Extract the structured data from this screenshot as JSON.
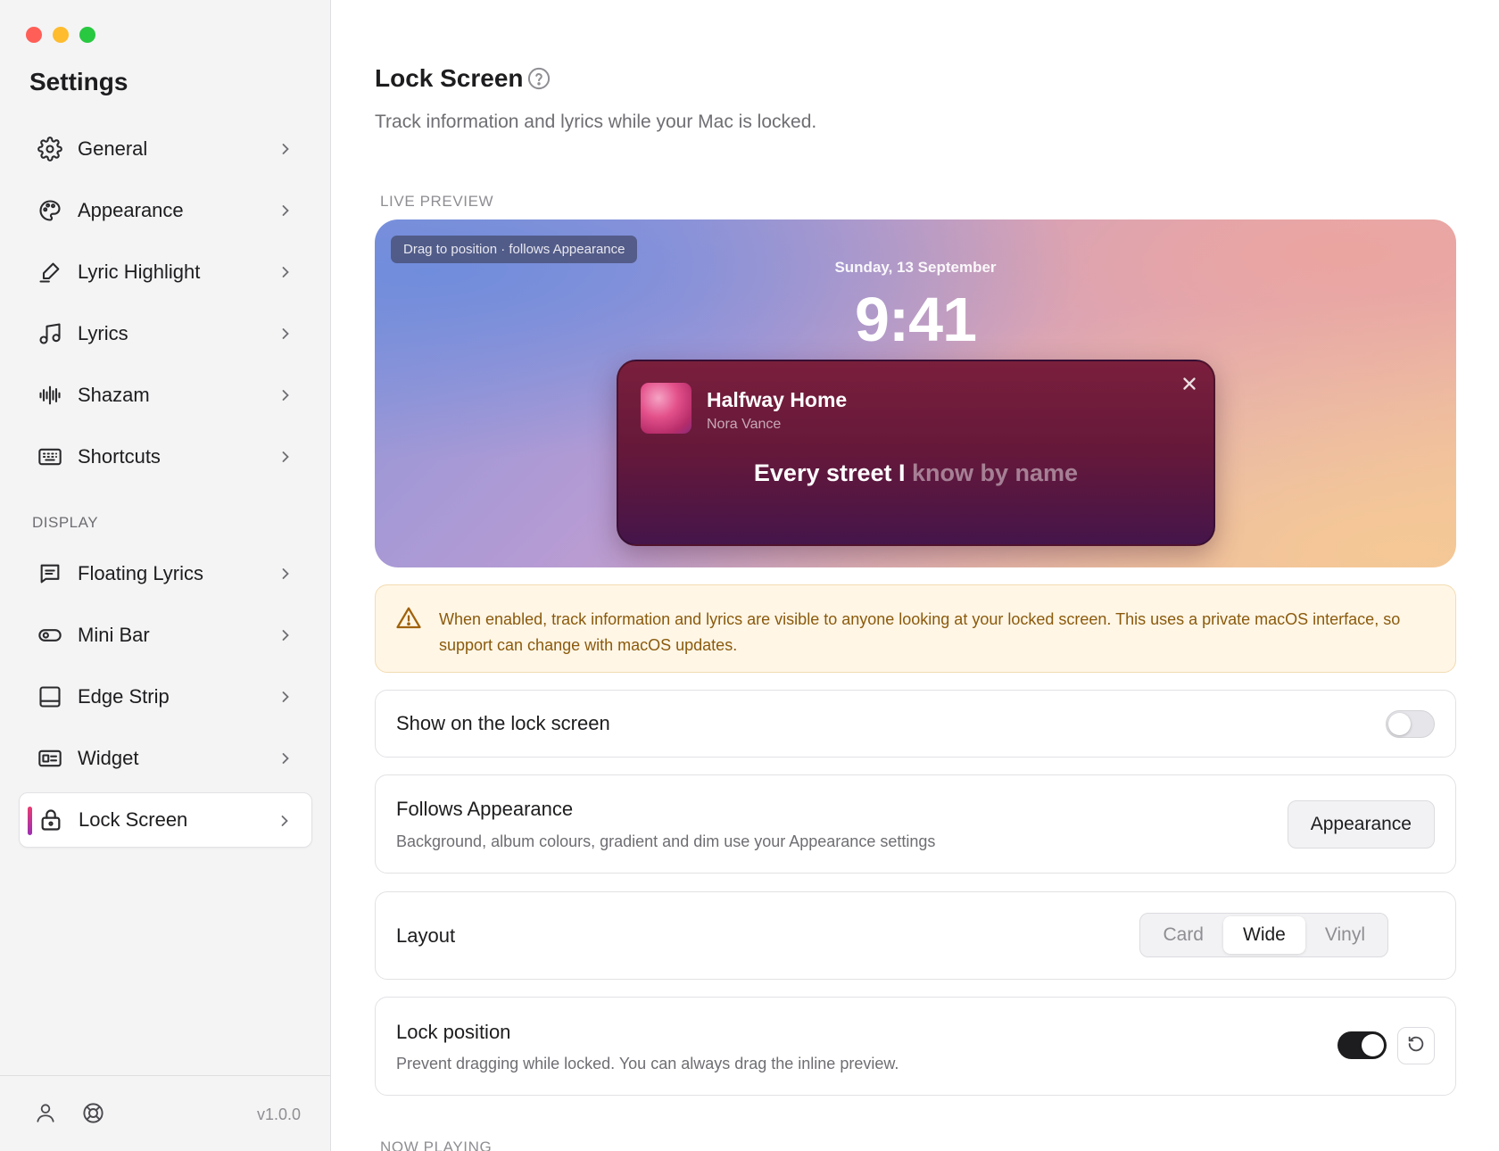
{
  "sidebar": {
    "title": "Settings",
    "items": [
      {
        "label": "General",
        "icon": "gear-icon"
      },
      {
        "label": "Appearance",
        "icon": "palette-icon"
      },
      {
        "label": "Lyric Highlight",
        "icon": "highlighter-icon"
      },
      {
        "label": "Lyrics",
        "icon": "music-note-icon"
      },
      {
        "label": "Shazam",
        "icon": "waveform-icon"
      },
      {
        "label": "Shortcuts",
        "icon": "keyboard-icon"
      }
    ],
    "section_label": "DISPLAY",
    "display_items": [
      {
        "label": "Floating Lyrics",
        "icon": "text-bubble-icon"
      },
      {
        "label": "Mini Bar",
        "icon": "pill-icon"
      },
      {
        "label": "Edge Strip",
        "icon": "edge-strip-icon"
      },
      {
        "label": "Widget",
        "icon": "widget-card-icon"
      },
      {
        "label": "Lock Screen",
        "icon": "lock-icon",
        "active": true
      }
    ],
    "version": "v1.0.0",
    "accent_gradient": [
      "#e83c72",
      "#9b2fb2"
    ]
  },
  "page": {
    "title": "Lock Screen",
    "subtitle": "Track information and lyrics while your Mac is locked.",
    "live_preview_label": "LIVE PREVIEW",
    "now_playing_label": "NOW PLAYING"
  },
  "preview": {
    "drag_hint": "Drag to position · follows Appearance",
    "date": "Sunday, 13 September",
    "time": "9:41",
    "track_title": "Halfway Home",
    "artist": "Nora Vance",
    "lyric_sung": "Every street I",
    "lyric_rest": " know by name"
  },
  "warning": {
    "text": "When enabled, track information and lyrics are visible to anyone looking at your locked screen. This uses a private macOS interface, so support can change with macOS updates.",
    "color": "#8a5a0c"
  },
  "settings": {
    "show_on_lock": {
      "label": "Show on the lock screen",
      "enabled": false
    },
    "follows_appearance": {
      "label": "Follows Appearance",
      "description": "Background, album colours, gradient and dim use your Appearance settings",
      "button": "Appearance"
    },
    "layout": {
      "label": "Layout",
      "options": [
        "Card",
        "Wide",
        "Vinyl"
      ],
      "selected": "Wide"
    },
    "lock_position": {
      "label": "Lock position",
      "description": "Prevent dragging while locked. You can always drag the inline preview.",
      "enabled": true
    }
  }
}
